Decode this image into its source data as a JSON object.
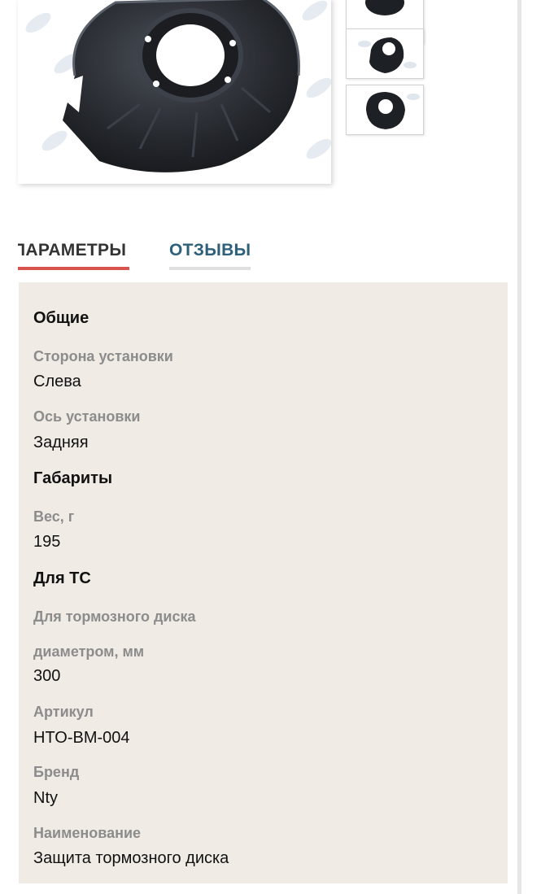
{
  "gallery": {
    "main_image_alt": "Защита тормозного диска",
    "thumbnails": [
      {
        "name": "thumb-1"
      },
      {
        "name": "thumb-2"
      },
      {
        "name": "thumb-3"
      }
    ]
  },
  "tabs": {
    "params_label": "ПАРАМЕТРЫ",
    "reviews_label": "ОТЗЫВЫ",
    "active": "params"
  },
  "specs": {
    "general": {
      "title": "Общие",
      "side_label": "Сторона установки",
      "side_value": "Слева",
      "axle_label": "Ось установки",
      "axle_value": "Задняя"
    },
    "dimensions": {
      "title": "Габариты",
      "weight_label": "Вес, г",
      "weight_value": "195"
    },
    "vehicle": {
      "title": "Для ТС",
      "disc_label_line1": "Для тормозного диска",
      "disc_label_line2": "диаметром, мм",
      "disc_value": "300",
      "article_label": "Артикул",
      "article_value": "HTO-BM-004",
      "brand_label": "Бренд",
      "brand_value": "Nty",
      "name_label": "Наименование",
      "name_value": "Защита тормозного диска"
    }
  },
  "colors": {
    "active_tab_underline": "#d9534f",
    "reviews_tab_text": "#2f6079",
    "specs_background": "#f1ebe6"
  }
}
